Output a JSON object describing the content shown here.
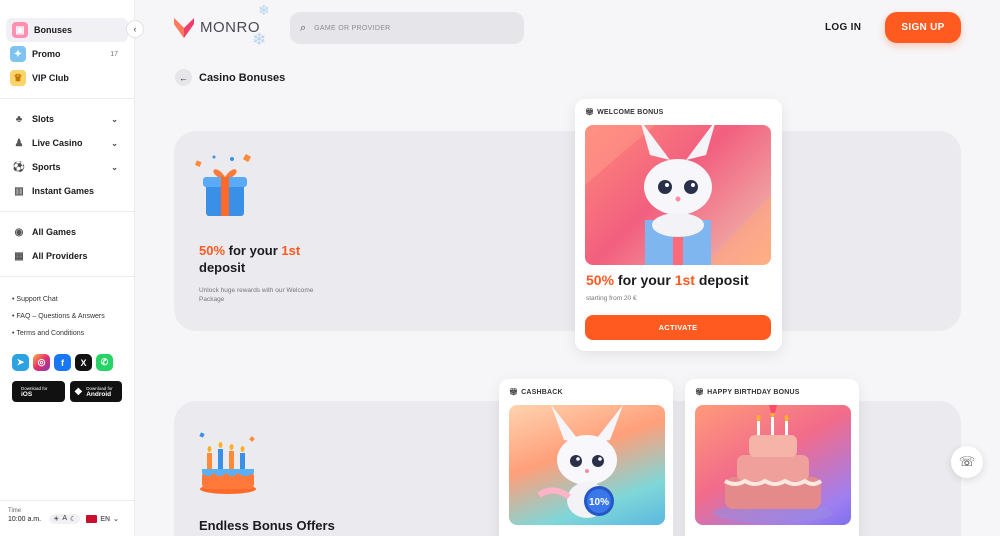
{
  "sidebar": {
    "primary": [
      {
        "label": "Bonuses",
        "icon": "gift-icon",
        "active": true
      },
      {
        "label": "Promo",
        "icon": "promo-icon",
        "count": "17"
      },
      {
        "label": "VIP Club",
        "icon": "crown-icon"
      }
    ],
    "games": [
      {
        "label": "Slots",
        "icon": "slots-icon"
      },
      {
        "label": "Live Casino",
        "icon": "live-casino-icon"
      },
      {
        "label": "Sports",
        "icon": "sports-icon"
      },
      {
        "label": "Instant Games",
        "icon": "instant-games-icon"
      }
    ],
    "browse": [
      {
        "label": "All Games",
        "icon": "all-games-icon"
      },
      {
        "label": "All Providers",
        "icon": "providers-icon"
      }
    ],
    "links": [
      "Support Chat",
      "FAQ – Questions & Answers",
      "Terms and Conditions"
    ],
    "social": [
      {
        "name": "telegram",
        "color": "#2aa3e0"
      },
      {
        "name": "instagram",
        "color": "#e1306c"
      },
      {
        "name": "facebook",
        "color": "#1877f2"
      },
      {
        "name": "x",
        "color": "#111111"
      },
      {
        "name": "whatsapp",
        "color": "#25d366"
      }
    ],
    "stores": [
      {
        "small": "Download for",
        "big": "iOS"
      },
      {
        "small": "Download for",
        "big": "Android"
      }
    ],
    "time_label": "Time",
    "time_value": "10:00 a.m.",
    "theme_label": "A",
    "lang": "EN"
  },
  "header": {
    "logo_text": "MONRO",
    "search_placeholder": "GAME OR PROVIDER",
    "login_label": "LOG IN",
    "signup_label": "SIGN UP"
  },
  "page": {
    "title": "Casino Bonuses"
  },
  "welcome_panel": {
    "title_pct": "50%",
    "title_mid": " for your ",
    "title_nth": "1st",
    "title_end": "deposit",
    "subtitle": "Unlock huge rewards with our Welcome Package"
  },
  "welcome_card": {
    "tag": "WELCOME BONUS",
    "title_pct": "50%",
    "title_mid": " for your ",
    "title_nth": "1st",
    "title_end": " deposit",
    "subtitle": "starting from 20 €",
    "button": "ACTIVATE"
  },
  "offers_panel": {
    "title": "Endless Bonus Offers"
  },
  "cashback_card": {
    "tag": "CASHBACK",
    "badge": "10%"
  },
  "birthday_card": {
    "tag": "HAPPY BIRTHDAY BONUS"
  },
  "colors": {
    "accent": "#ff5a1f",
    "panel": "#ebebef"
  }
}
